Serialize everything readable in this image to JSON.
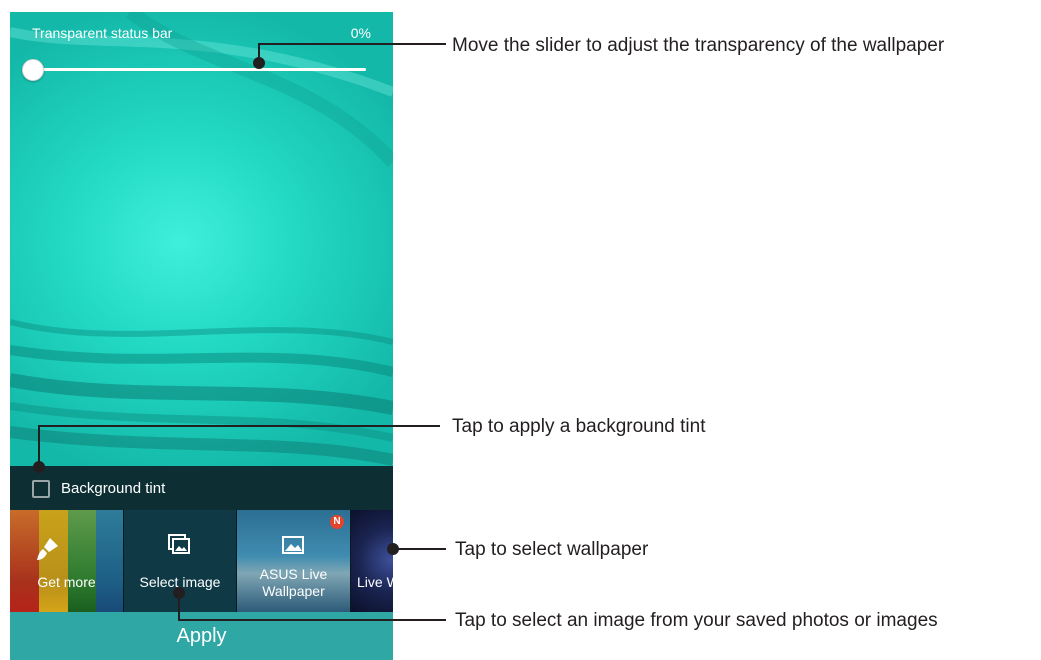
{
  "screen": {
    "status_label": "Transparent status bar",
    "status_value": "0%",
    "transparency_value": 0,
    "tint_label": "Background tint",
    "tint_checked": false,
    "thumbnails": [
      {
        "label": "Get more",
        "icon": "paintbrush-icon"
      },
      {
        "label": "Select image",
        "icon": "gallery-icon"
      },
      {
        "label_line1": "ASUS Live",
        "label_line2": "Wallpaper",
        "badge": "N",
        "icon": "image-icon"
      },
      {
        "label": "Live W"
      }
    ],
    "apply_label": "Apply"
  },
  "callouts": [
    "Move the slider to adjust the transparency of the wallpaper",
    "Tap to apply a background tint",
    "Tap to select wallpaper",
    "Tap to select an image from your saved photos or images"
  ],
  "colors": {
    "accent": "#2ea7a5",
    "wallpaper": "#22d9c4",
    "tint_bar": "#0d2f33",
    "badge": "#e4442c"
  }
}
